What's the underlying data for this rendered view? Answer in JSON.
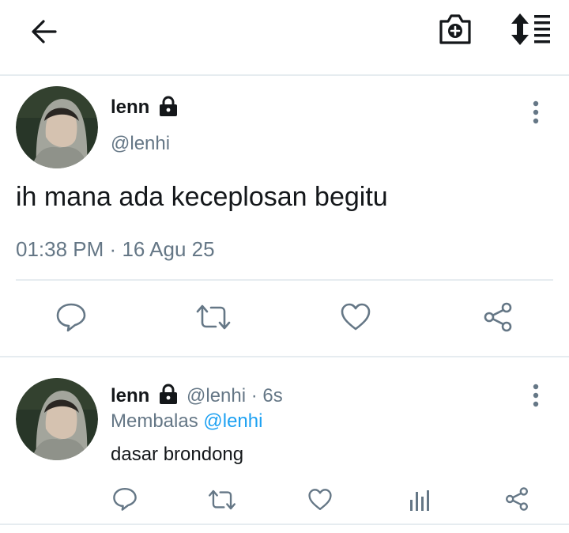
{
  "header": {
    "back_icon": "arrow-left-icon",
    "camera_icon": "camera-add-icon",
    "sort_icon": "sort-list-icon"
  },
  "main_tweet": {
    "name": "lenn",
    "handle": "@lenhi",
    "text": "ih mana ada keceplosan begitu",
    "time": "01:38 PM",
    "dot": "·",
    "date": "16 Agu 25",
    "lock_icon": "lock-icon",
    "more_icon": "more-vertical-icon",
    "actions": [
      "reply-icon",
      "retweet-icon",
      "like-icon",
      "share-icon"
    ]
  },
  "reply_tweet": {
    "name": "lenn",
    "handle": "@lenhi",
    "age": "· 6s",
    "replying_prefix": "Membalas",
    "replying_to": "@lenhi",
    "text": "dasar brondong",
    "lock_icon": "lock-icon",
    "more_icon": "more-vertical-icon",
    "actions": [
      "reply-icon",
      "retweet-icon",
      "like-icon",
      "analytics-icon",
      "share-icon"
    ]
  },
  "colors": {
    "text": "#14171a",
    "muted": "#657786",
    "link": "#1da1f2",
    "divider": "#e6ecf0"
  }
}
